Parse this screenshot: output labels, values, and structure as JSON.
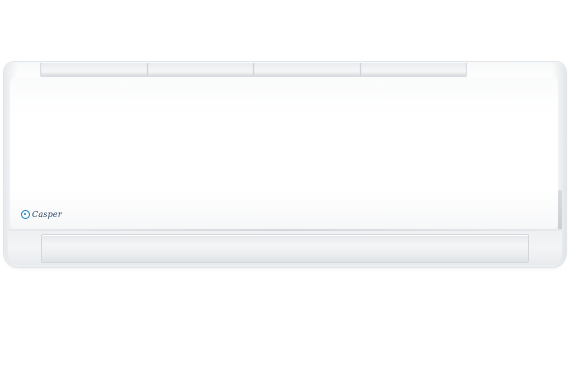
{
  "product": {
    "brand_logo_text": "Casper",
    "logo_icon": "casper-logo-mark-icon",
    "colors": {
      "body": "#ffffff",
      "logo_accent": "#1a7fc1",
      "logo_text": "#1e3a5a",
      "background": "#ffffff"
    }
  }
}
